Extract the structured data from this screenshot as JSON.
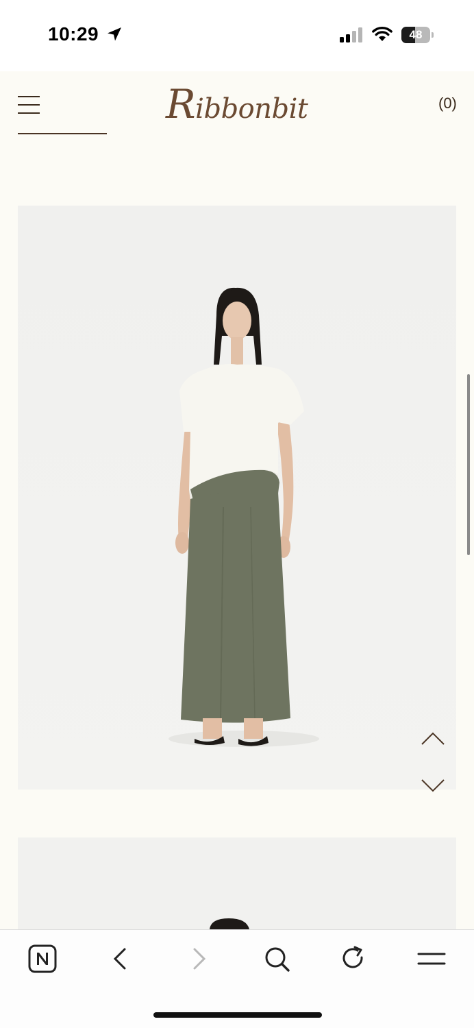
{
  "status_bar": {
    "time": "10:29",
    "battery_level": "48",
    "battery_fraction": 0.48
  },
  "header": {
    "logo": "Ribbonbit",
    "logo_initial": "R",
    "logo_rest": "ibbonbit",
    "cart_count": "(0)"
  },
  "colors": {
    "page_background": "#fcfbf5",
    "logo_brown": "#6b4a32",
    "photo_background": "#f1f1ef",
    "skirt_olive": "#6e7460"
  },
  "gallery": {
    "images": [
      "model-white-top-olive-skirt",
      "model-second-photo"
    ]
  },
  "browser_toolbar": {
    "icons": [
      "naver-icon",
      "back-icon",
      "forward-icon",
      "search-icon",
      "reload-icon",
      "menu-icon"
    ]
  }
}
